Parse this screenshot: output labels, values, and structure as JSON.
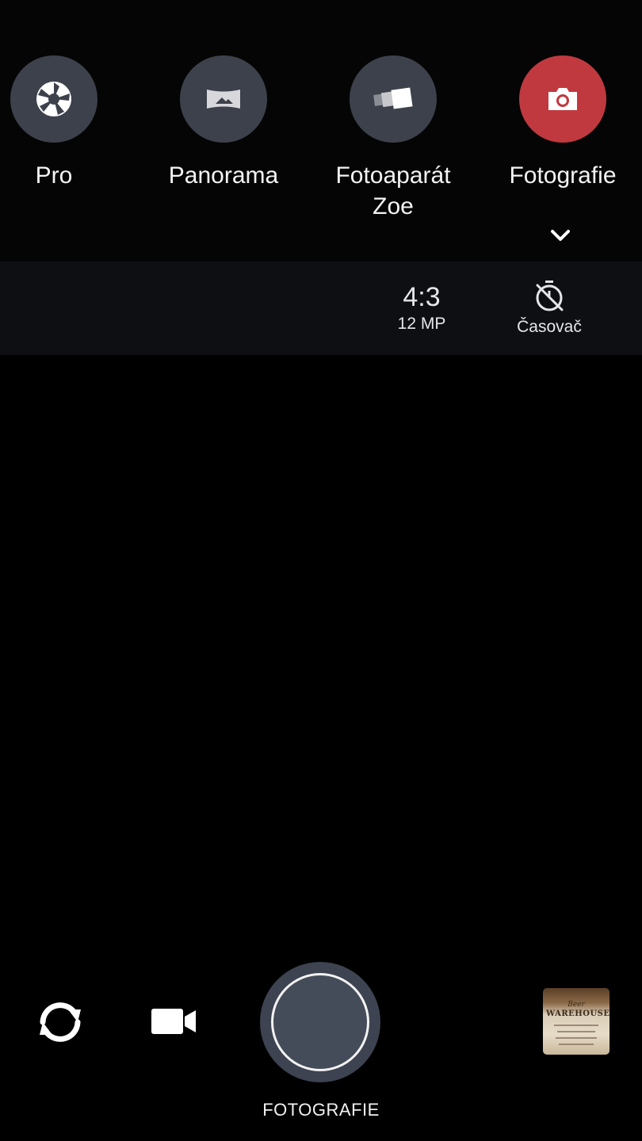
{
  "modes": [
    {
      "label": "Pro",
      "icon": "aperture-icon",
      "active": false
    },
    {
      "label": "Panorama",
      "icon": "panorama-icon",
      "active": false
    },
    {
      "label": "Fotoaparát Zoe",
      "icon": "zoe-camera-icon",
      "active": false
    },
    {
      "label": "Fotografie",
      "icon": "camera-icon",
      "active": true
    }
  ],
  "expand_icon": "chevron-down-icon",
  "settings": {
    "aspect_ratio": "4:3",
    "resolution": "12 MP",
    "timer_label": "Časovač",
    "timer_icon": "timer-off-icon"
  },
  "controls": {
    "switch_camera_icon": "switch-camera-icon",
    "video_icon": "video-camera-icon",
    "shutter_icon": "shutter-button",
    "mode_caption": "FOTOGRAFIE",
    "gallery_thumbnail_text": [
      "Beer",
      "WAREHOUSE"
    ]
  },
  "colors": {
    "active_mode": "#c0393f",
    "inactive_mode": "#3d414b",
    "settings_bar": "#0d0f12",
    "background": "#000000"
  }
}
